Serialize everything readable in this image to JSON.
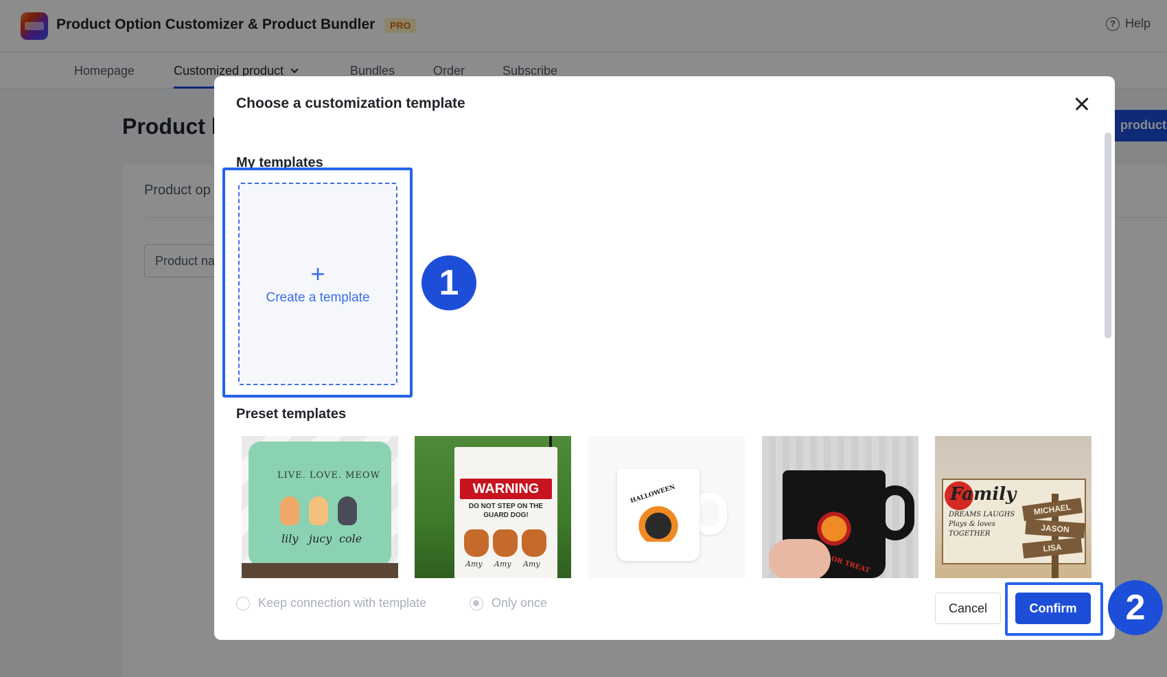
{
  "app": {
    "title": "Product Option Customizer & Product Bundler",
    "badge": "PRO",
    "help_label": "Help"
  },
  "nav": {
    "tabs": [
      {
        "label": "Homepage"
      },
      {
        "label": "Customized product"
      },
      {
        "label": "Bundles"
      },
      {
        "label": "Order"
      },
      {
        "label": "Subscribe"
      }
    ],
    "active_tab": "Customized product"
  },
  "page": {
    "title": "Product l",
    "action_button": "products",
    "card_heading": "Product op",
    "search_placeholder": "Product na"
  },
  "modal": {
    "title": "Choose a customization template",
    "my_templates_label": "My templates",
    "create_label": "Create a template",
    "preset_label": "Preset templates",
    "presets": [
      {
        "name": "cat-pillow",
        "text": "LIVE. LOVE. MEOW",
        "names": [
          "lily",
          "jucy",
          "cole"
        ]
      },
      {
        "name": "dog-flag",
        "text": "WARNING",
        "subtext": "DO NOT STEP ON THE GUARD DOG!",
        "names": [
          "Amy",
          "Amy",
          "Amy"
        ]
      },
      {
        "name": "halloween-white-mug",
        "text": "HALLOWEEN"
      },
      {
        "name": "halloween-black-mug",
        "text": "TRICK OR TREAT"
      },
      {
        "name": "family-wood-sign",
        "text": "Family",
        "subtext": "DREAMS LAUGHS Plays & loves TOGETHER",
        "names": [
          "MICHAEL",
          "JASON",
          "LISA"
        ]
      }
    ],
    "radio_keep": {
      "label": "Keep connection with template",
      "checked": false
    },
    "radio_once": {
      "label": "Only once",
      "checked": true
    },
    "cancel_label": "Cancel",
    "confirm_label": "Confirm"
  },
  "annotations": {
    "step1": "1",
    "step2": "2"
  },
  "colors": {
    "primary": "#1d4ed8",
    "annotation": "#2563eb",
    "badge_bg": "#fff1c2",
    "badge_text": "#d46b08"
  }
}
